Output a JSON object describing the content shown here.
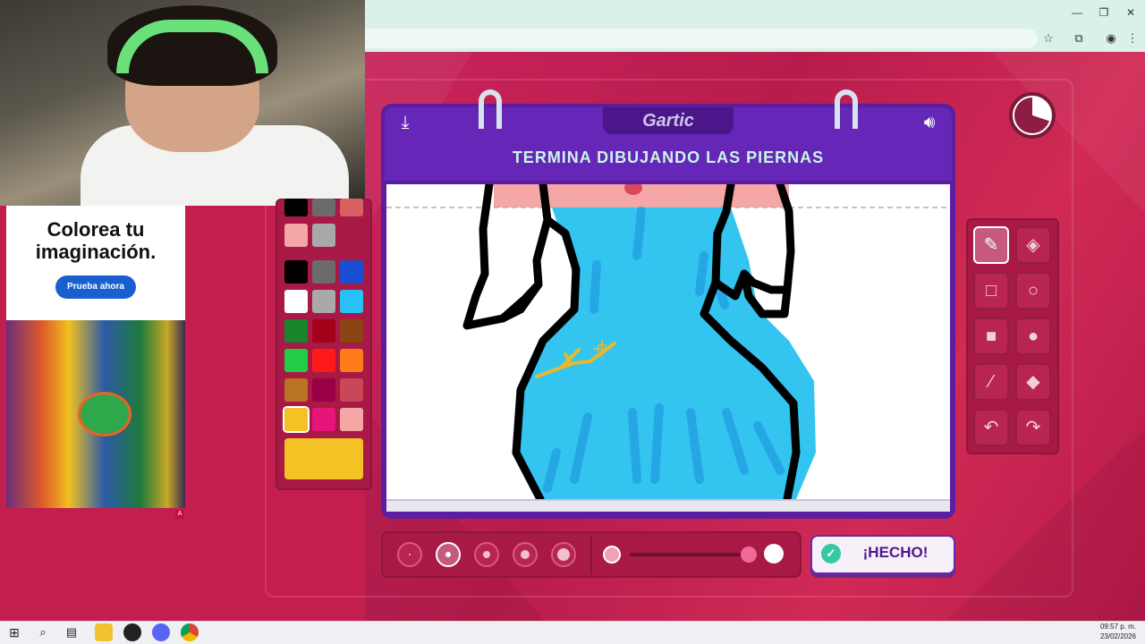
{
  "browser": {
    "window_controls": {
      "minimize": "—",
      "restore": "❐",
      "close": "✕"
    },
    "toolbar_icons": {
      "bookmark": "star-icon",
      "extensions": "puzzle-icon",
      "profile": "profile-icon",
      "menu": "kebab-menu-icon"
    }
  },
  "ad": {
    "title": "Colorea tu imaginación.",
    "cta": "Prueba ahora",
    "badge": "A"
  },
  "palette": {
    "colors": [
      "#000000",
      "#6b6b6b",
      "#1a4fcf",
      "#ffffff",
      "#a9a9a9",
      "#27c1f5",
      "#17852a",
      "#a3001a",
      "#8b4513",
      "#22cc44",
      "#ff1a1a",
      "#ff7a1a",
      "#b87422",
      "#9a0045",
      "#c8485a",
      "#f5c226",
      "#e6157a",
      "#f5a6a6"
    ],
    "partial_colors": [
      "#000000",
      "#6b6b6b",
      "#d86060",
      "#f5a6a6",
      "#a9a9a9"
    ],
    "selected_color": "#f5c226"
  },
  "notebook": {
    "logo": "Gartic",
    "task": "TERMINA DIBUJANDO LAS PIERNAS",
    "download_icon": "download-icon",
    "volume_icon": "volume-icon"
  },
  "timer": {
    "remaining_fraction": 0.3
  },
  "tools": [
    {
      "name": "pencil",
      "glyph": "✎",
      "selected": true
    },
    {
      "name": "eraser",
      "glyph": "◈",
      "selected": false
    },
    {
      "name": "rectangle-outline",
      "glyph": "□",
      "selected": false
    },
    {
      "name": "ellipse-outline",
      "glyph": "○",
      "selected": false
    },
    {
      "name": "rectangle-fill",
      "glyph": "■",
      "selected": false
    },
    {
      "name": "ellipse-fill",
      "glyph": "●",
      "selected": false
    },
    {
      "name": "line",
      "glyph": "⁄",
      "selected": false
    },
    {
      "name": "fill-bucket",
      "glyph": "◆",
      "selected": false
    },
    {
      "name": "undo",
      "glyph": "↶",
      "selected": false
    },
    {
      "name": "redo",
      "glyph": "↷",
      "selected": false
    }
  ],
  "brush": {
    "sizes": 5,
    "selected_size_index": 1,
    "opacity": 1.0
  },
  "done_button": {
    "label": "¡HECHO!",
    "icon": "check-icon"
  },
  "taskbar": {
    "icons": [
      "windows-start-icon",
      "search-icon",
      "task-view-icon",
      "file-explorer-icon",
      "app-icon",
      "discord-icon",
      "chrome-icon"
    ],
    "time": "09:57 p. m.",
    "date": "23/02/2026"
  }
}
